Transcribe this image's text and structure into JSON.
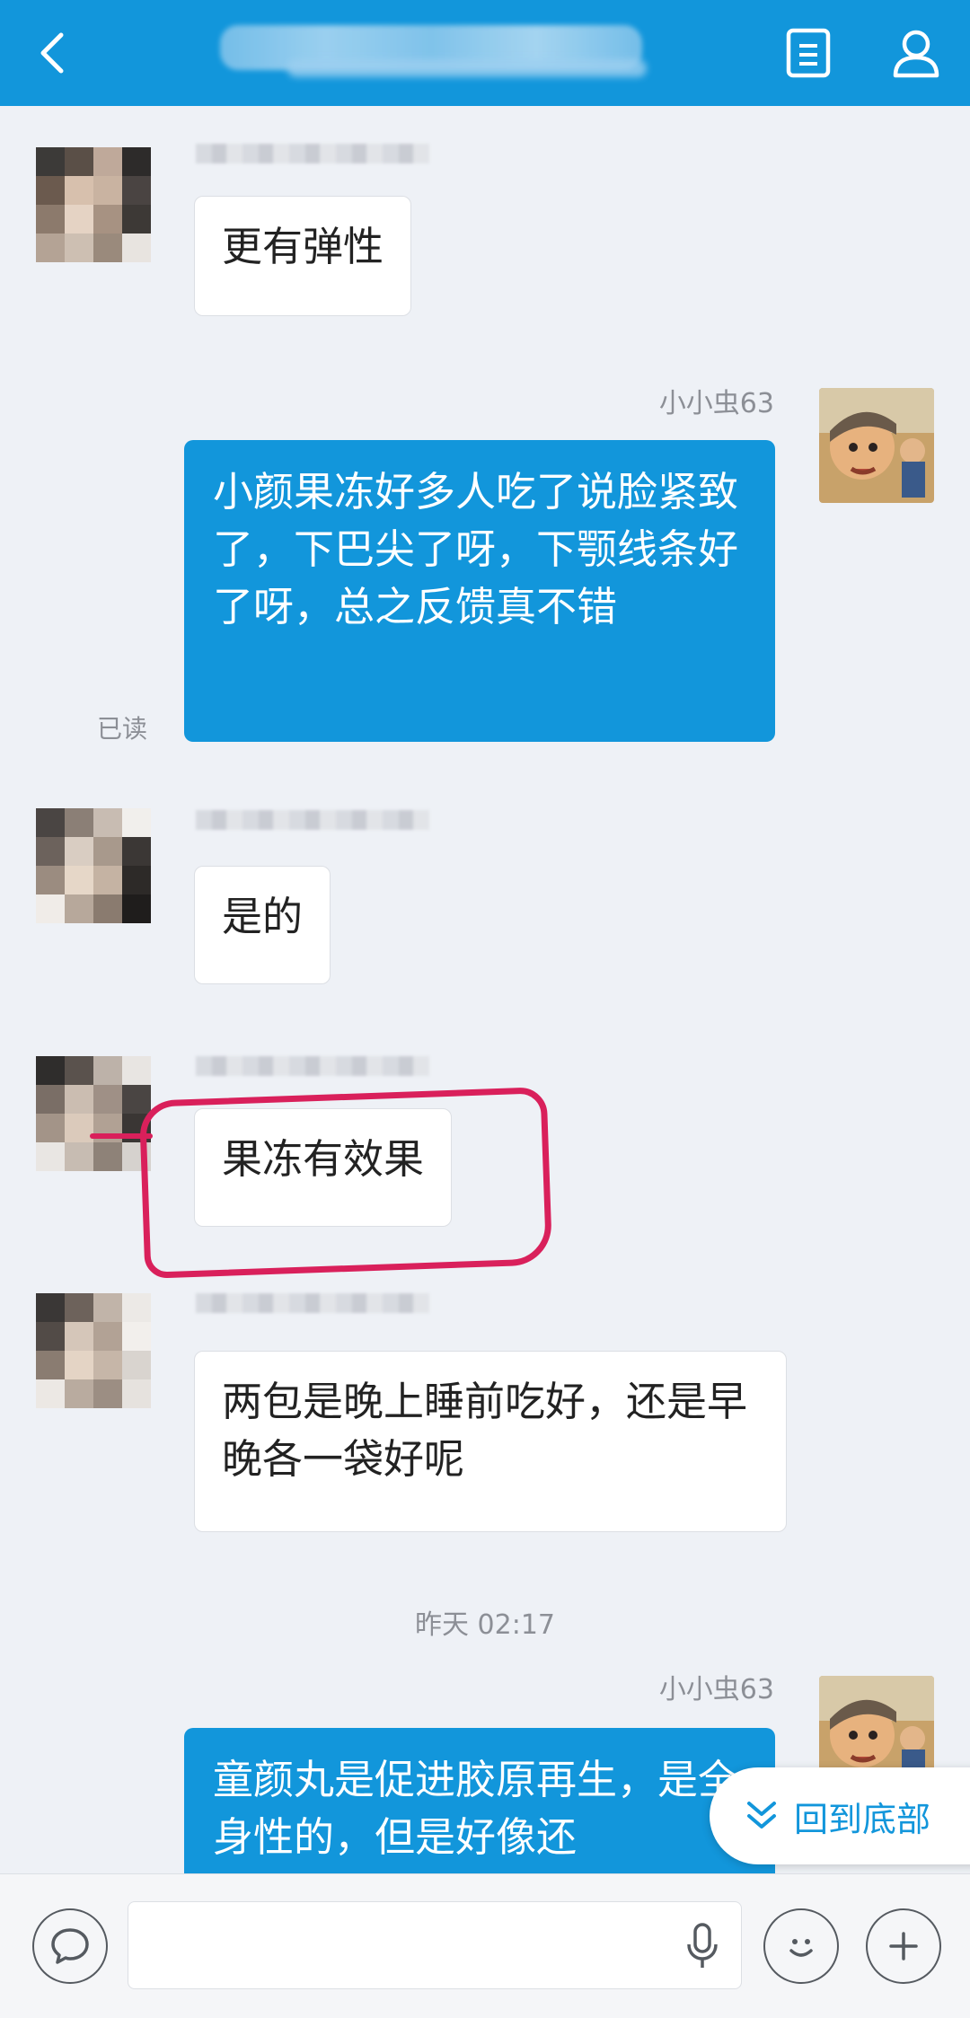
{
  "header": {
    "back_icon": "chevron-left-icon",
    "profile_doc_icon": "document-icon",
    "person_icon": "person-icon",
    "color": "#1296db"
  },
  "messages": [
    {
      "side": "in",
      "text": "更有弹性"
    },
    {
      "side": "out",
      "nickname": "小小虫63",
      "text": "小颜果冻好多人吃了说脸紧致了，下巴尖了呀，下颚线条好了呀，总之反馈真不错",
      "status": "已读"
    },
    {
      "side": "in",
      "text": "是的"
    },
    {
      "side": "in",
      "text": "果冻有效果"
    },
    {
      "side": "in",
      "text": "两包是晚上睡前吃好，还是早晚各一袋好呢"
    },
    {
      "timestamp": "昨天 02:17"
    },
    {
      "side": "out",
      "nickname": "小小虫63",
      "text": "童颜丸是促进胶原再生，是全身性的，但是好像还"
    }
  ],
  "scroll_button": {
    "label": "回到底部",
    "icon": "chevron-double-down-icon"
  },
  "input_bar": {
    "value": "",
    "voice_icon": "chat-bubble-icon",
    "mic_icon": "microphone-icon",
    "emoji_icon": "smiley-icon",
    "plus_icon": "plus-icon"
  },
  "colors": {
    "accent": "#1296db",
    "annotation": "#d9205b",
    "background": "#eef1f6"
  }
}
